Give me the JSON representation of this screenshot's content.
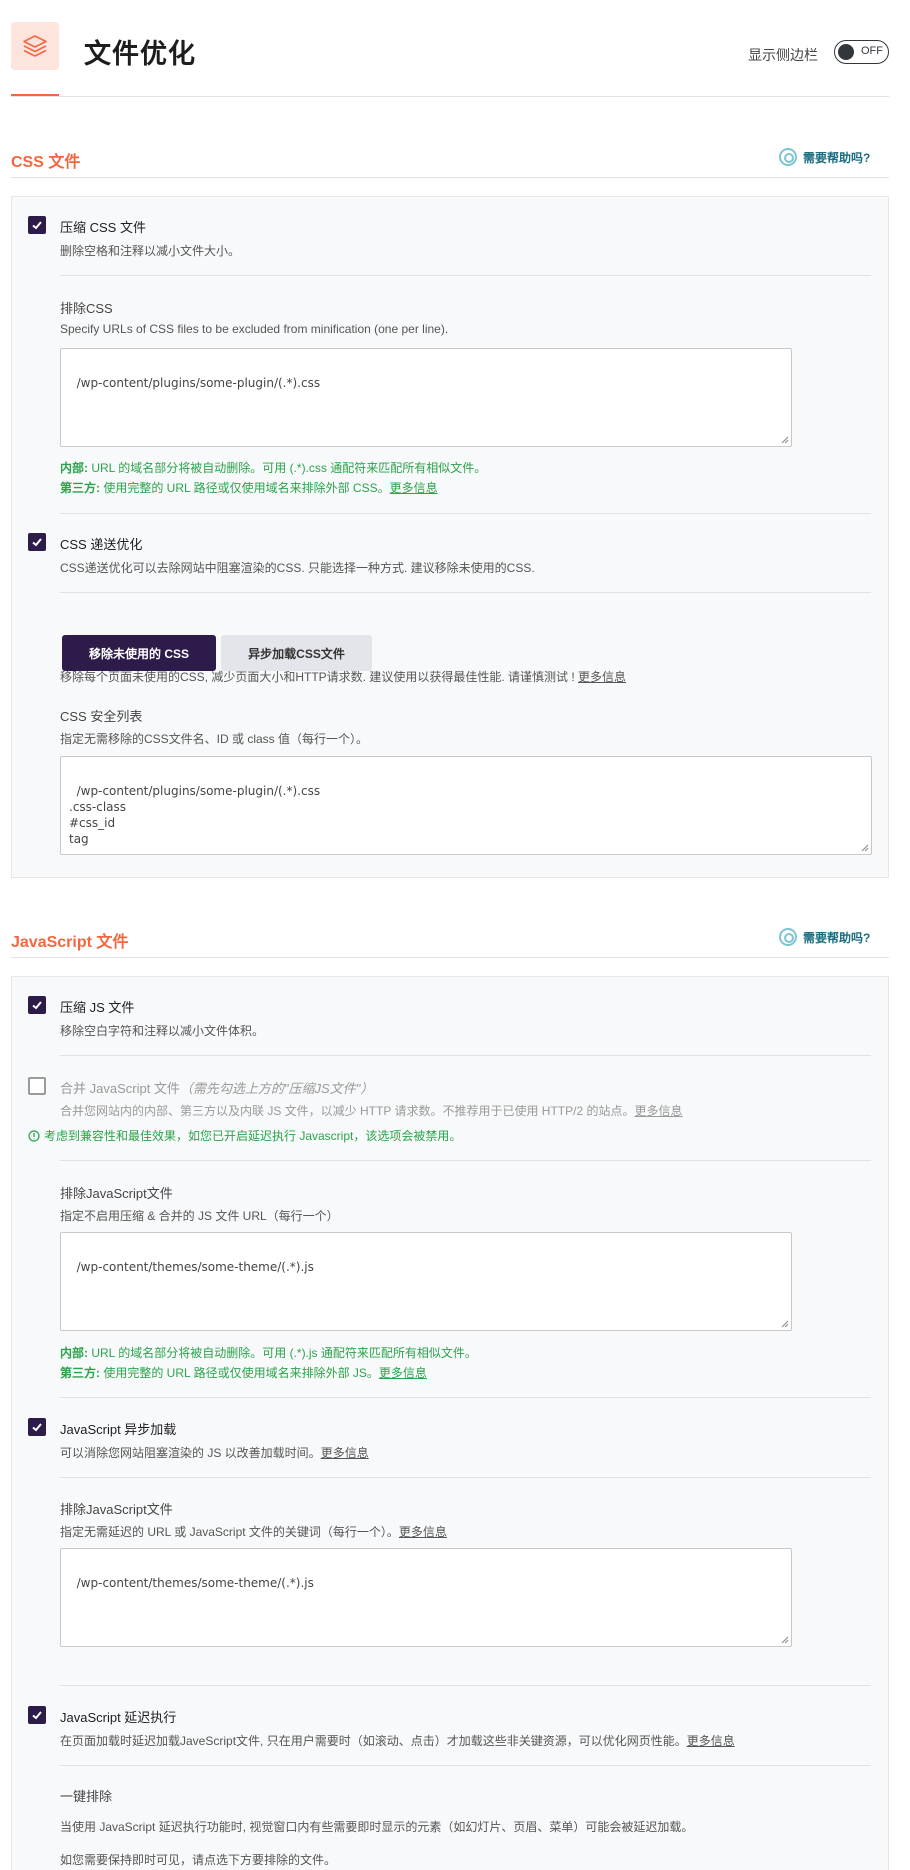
{
  "header": {
    "title": "文件优化",
    "sidebar_label": "显示侧边栏",
    "toggle_state": "OFF"
  },
  "css_section": {
    "title": "CSS 文件",
    "help": "需要帮助吗?",
    "minify": {
      "checked": true,
      "label": "压缩 CSS 文件",
      "desc": "删除空格和注释以减小文件大小。"
    },
    "exclude": {
      "title": "排除CSS",
      "desc": "Specify URLs of CSS files to be excluded from minification (one per line).",
      "value": "/wp-content/plugins/some-plugin/(.*).css",
      "note_internal_label": "内部:",
      "note_internal": " URL 的域名部分将被自动删除。可用 (.*).css 通配符来匹配所有相似文件。",
      "note_third_label": "第三方:",
      "note_third": " 使用完整的 URL 路径或仅使用域名来排除外部 CSS。",
      "note_link": "更多信息"
    },
    "delivery": {
      "checked": true,
      "label": "CSS 递送优化",
      "desc": "CSS递送优化可以去除网站中阻塞渲染的CSS. 只能选择一种方式. 建议移除未使用的CSS."
    },
    "buttons": {
      "remove_unused": "移除未使用的 CSS",
      "async_load": "异步加载CSS文件"
    },
    "remove_desc": "移除每个页面未使用的CSS, 减少页面大小和HTTP请求数. 建议使用以获得最佳性能. 请谨慎测试 ! ",
    "remove_link": "更多信息",
    "safelist": {
      "title": "CSS 安全列表",
      "desc": "指定无需移除的CSS文件名、ID 或 class 值（每行一个）。",
      "value": "/wp-content/plugins/some-plugin/(.*).css\n.css-class\n#css_id\ntag"
    }
  },
  "js_section": {
    "title": "JavaScript 文件",
    "help": "需要帮助吗?",
    "minify": {
      "checked": true,
      "label": "压缩 JS 文件",
      "desc": "移除空白字符和注释以减小文件体积。"
    },
    "combine": {
      "checked": false,
      "label": "合并 JavaScript 文件",
      "label_hint": "（需先勾选上方的\"压缩JS文件\"）",
      "desc": "合并您网站内的内部、第三方以及内联 JS 文件，以减少 HTTP 请求数。不推荐用于已使用 HTTP/2 的站点。",
      "link": "更多信息",
      "warning": "考虑到兼容性和最佳效果，如您已开启延迟执行 Javascript，该选项会被禁用。"
    },
    "exclude": {
      "title": "排除JavaScript文件",
      "desc": "指定不启用压缩 & 合并的 JS 文件 URL（每行一个）",
      "value": "/wp-content/themes/some-theme/(.*).js",
      "note_internal_label": "内部:",
      "note_internal": " URL 的域名部分将被自动删除。可用 (.*).js 通配符来匹配所有相似文件。",
      "note_third_label": "第三方:",
      "note_third": " 使用完整的 URL 路径或仅使用域名来排除外部 JS。",
      "note_link": "更多信息"
    },
    "async": {
      "checked": true,
      "label": "JavaScript 异步加载",
      "desc": "可以消除您网站阻塞渲染的 JS 以改善加载时间。",
      "link": "更多信息"
    },
    "async_exclude": {
      "title": "排除JavaScript文件",
      "desc": "指定无需延迟的 URL 或 JavaScript 文件的关键词（每行一个）。",
      "link": "更多信息",
      "value": "/wp-content/themes/some-theme/(.*).js"
    },
    "delay": {
      "checked": true,
      "label": "JavaScript 延迟执行",
      "desc": "在页面加载时延迟加载JaveScript文件, 只在用户需要时（如滚动、点击）才加载这些非关键资源，可以优化网页性能。",
      "link": "更多信息"
    },
    "one_click": {
      "title": "一键排除",
      "desc1": "当使用 JavaScript 延迟执行功能时, 视觉窗口内有些需要即时显示的元素（如幻灯片、页眉、菜单）可能会被延迟加载。",
      "desc2": "如您需要保持即时可见，请点选下方要排除的文件。"
    }
  }
}
